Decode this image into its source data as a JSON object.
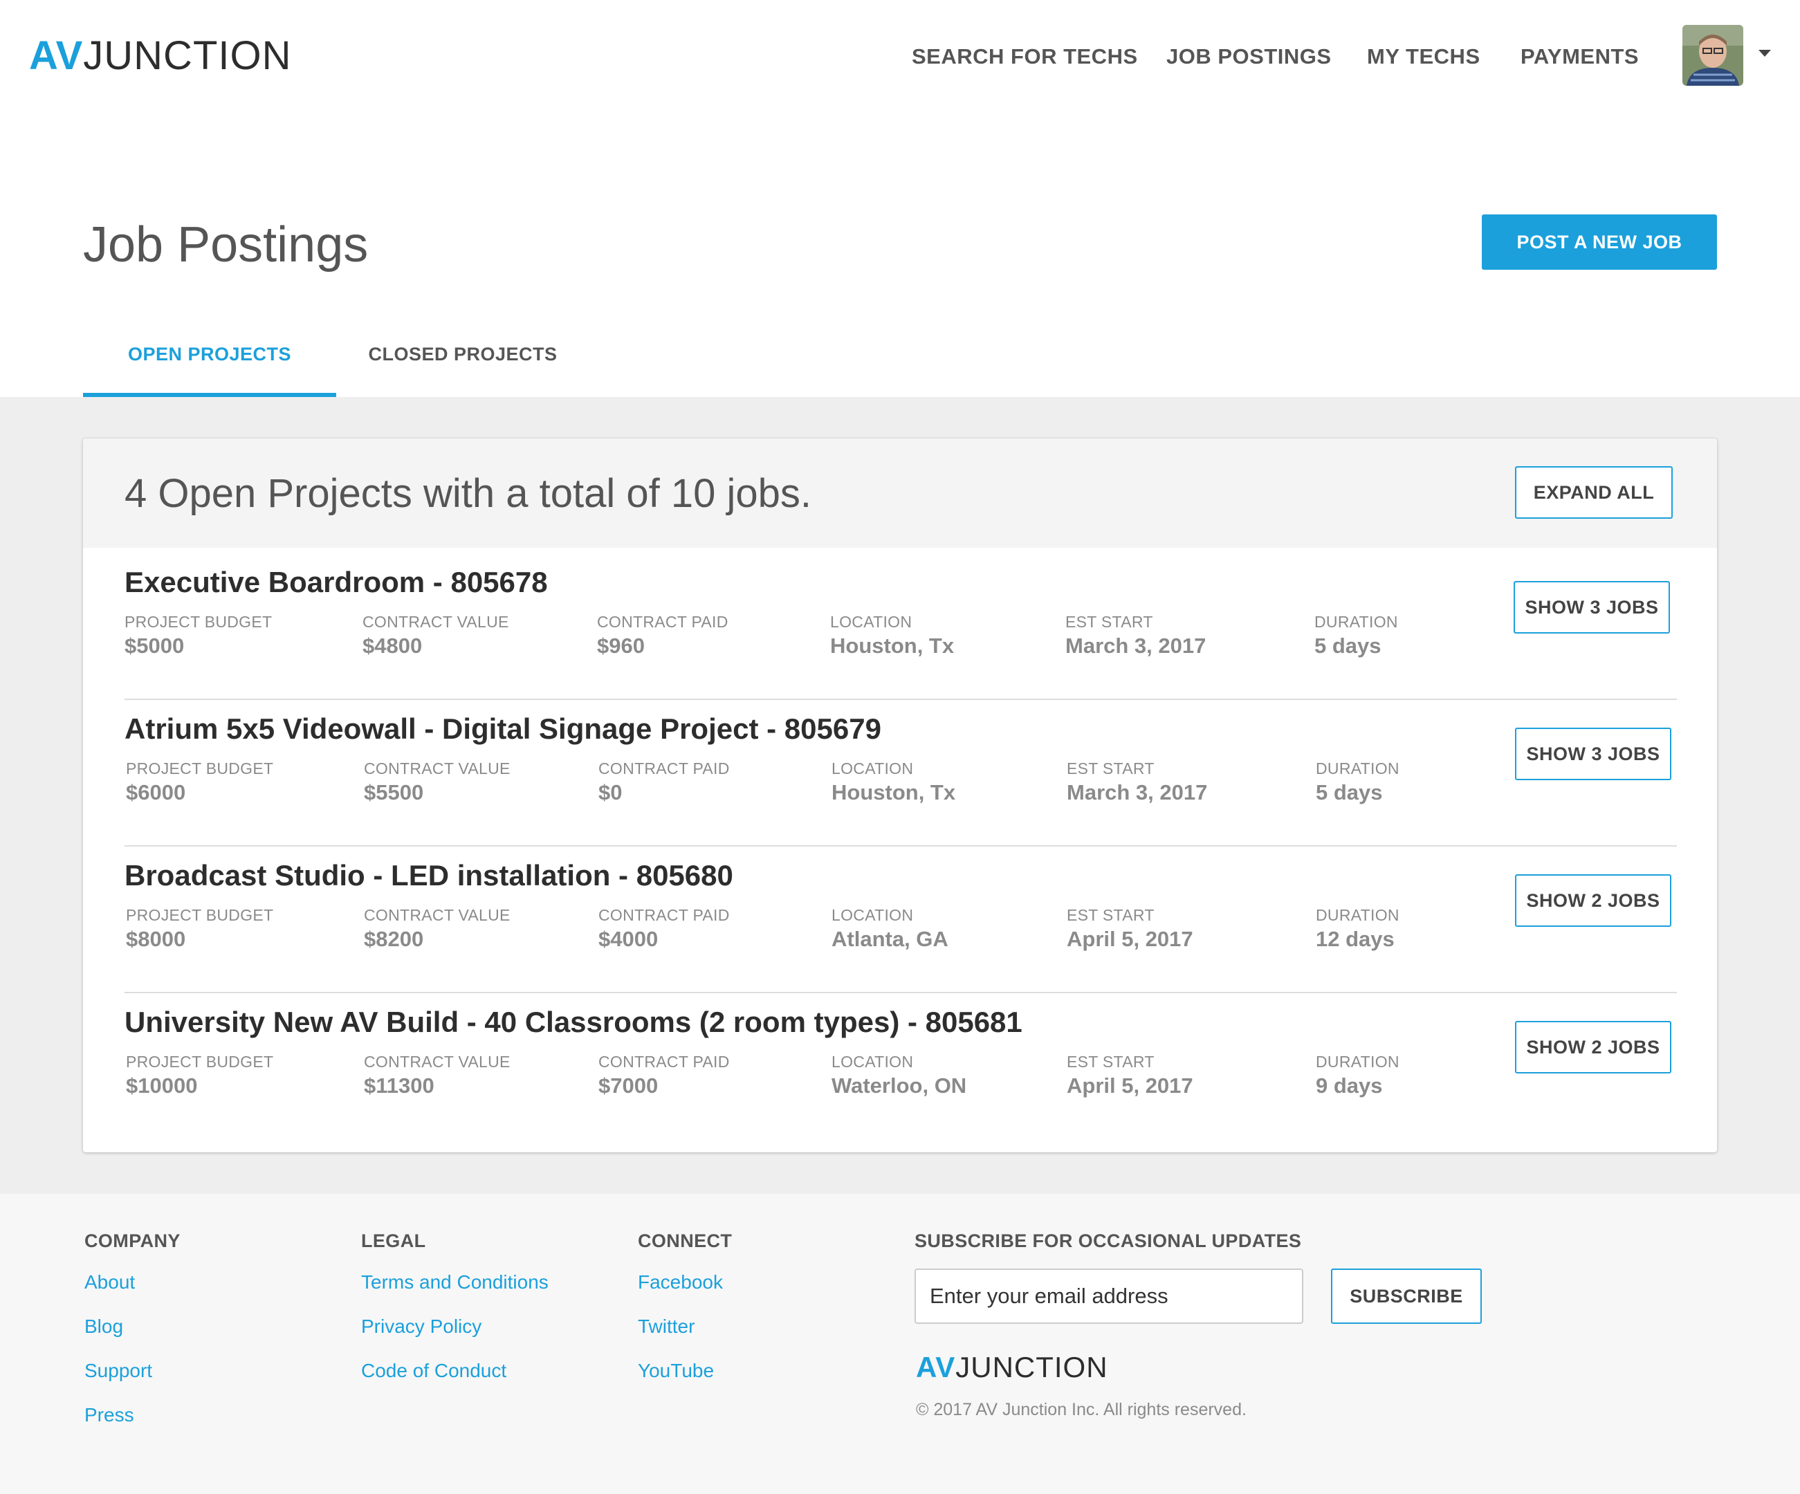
{
  "brand": {
    "logo_av": "AV",
    "logo_junction": "JUNCTION"
  },
  "nav": {
    "items": [
      "SEARCH FOR TECHS",
      "JOB POSTINGS",
      "MY TECHS",
      "PAYMENTS"
    ]
  },
  "page": {
    "title": "Job Postings",
    "post_button": "POST A NEW JOB",
    "tabs": [
      {
        "label": "OPEN PROJECTS",
        "active": true
      },
      {
        "label": "CLOSED PROJECTS",
        "active": false
      }
    ]
  },
  "summary": {
    "text": "4 Open Projects with a total of 10 jobs.",
    "expand_button": "EXPAND ALL"
  },
  "field_labels": {
    "budget": "PROJECT BUDGET",
    "contract_value": "CONTRACT VALUE",
    "contract_paid": "CONTRACT PAID",
    "location": "LOCATION",
    "est_start": "EST START",
    "duration": "DURATION"
  },
  "projects": [
    {
      "title": "Executive Boardroom - 805678",
      "budget": "$5000",
      "contract_value": "$4800",
      "contract_paid": "$960",
      "location": "Houston, Tx",
      "est_start": "March 3, 2017",
      "duration": "5 days",
      "button": "SHOW 3 JOBS"
    },
    {
      "title": "Atrium 5x5 Videowall - Digital Signage Project - 805679",
      "budget": "$6000",
      "contract_value": "$5500",
      "contract_paid": "$0",
      "location": "Houston, Tx",
      "est_start": "March 3, 2017",
      "duration": "5 days",
      "button": "SHOW 3 JOBS"
    },
    {
      "title": "Broadcast Studio - LED installation - 805680",
      "budget": "$8000",
      "contract_value": "$8200",
      "contract_paid": "$4000",
      "location": "Atlanta, GA",
      "est_start": "April 5, 2017",
      "duration": "12 days",
      "button": "SHOW 2 JOBS"
    },
    {
      "title": "University New AV Build - 40 Classrooms (2 room types) - 805681",
      "budget": "$10000",
      "contract_value": "$11300",
      "contract_paid": "$7000",
      "location": "Waterloo, ON",
      "est_start": "April 5, 2017",
      "duration": "9 days",
      "button": "SHOW 2 JOBS"
    }
  ],
  "footer": {
    "company": {
      "heading": "COMPANY",
      "links": [
        "About",
        "Blog",
        "Support",
        "Press"
      ]
    },
    "legal": {
      "heading": "LEGAL",
      "links": [
        "Terms and Conditions",
        "Privacy Policy",
        "Code of Conduct"
      ]
    },
    "connect": {
      "heading": "CONNECT",
      "links": [
        "Facebook",
        "Twitter",
        "YouTube"
      ]
    },
    "subscribe": {
      "heading": "SUBSCRIBE FOR OCCASIONAL UPDATES",
      "placeholder": "Enter your email address",
      "button": "SUBSCRIBE"
    },
    "copyright": "© 2017 AV Junction Inc. All rights reserved."
  },
  "colors": {
    "accent": "#1ba0db",
    "text_dark": "#2d2d2d",
    "text_muted": "#8a8a8a",
    "gray_bg": "#eeeeee"
  },
  "icons": {
    "user_avatar": "avatar",
    "account_menu": "caret-down-icon"
  }
}
